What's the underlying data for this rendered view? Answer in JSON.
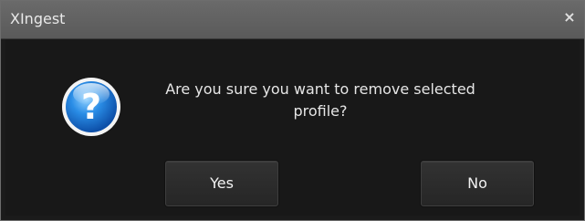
{
  "window": {
    "title": "XIngest",
    "close_glyph": "×"
  },
  "dialog": {
    "icon": "question-icon",
    "message": "Are you sure you want to remove selected profile?",
    "buttons": {
      "yes": "Yes",
      "no": "No"
    }
  },
  "colors": {
    "titlebar": "#5f5f5f",
    "body": "#181818",
    "button": "#2b2b2b",
    "icon_blue": "#1f6fd1"
  }
}
